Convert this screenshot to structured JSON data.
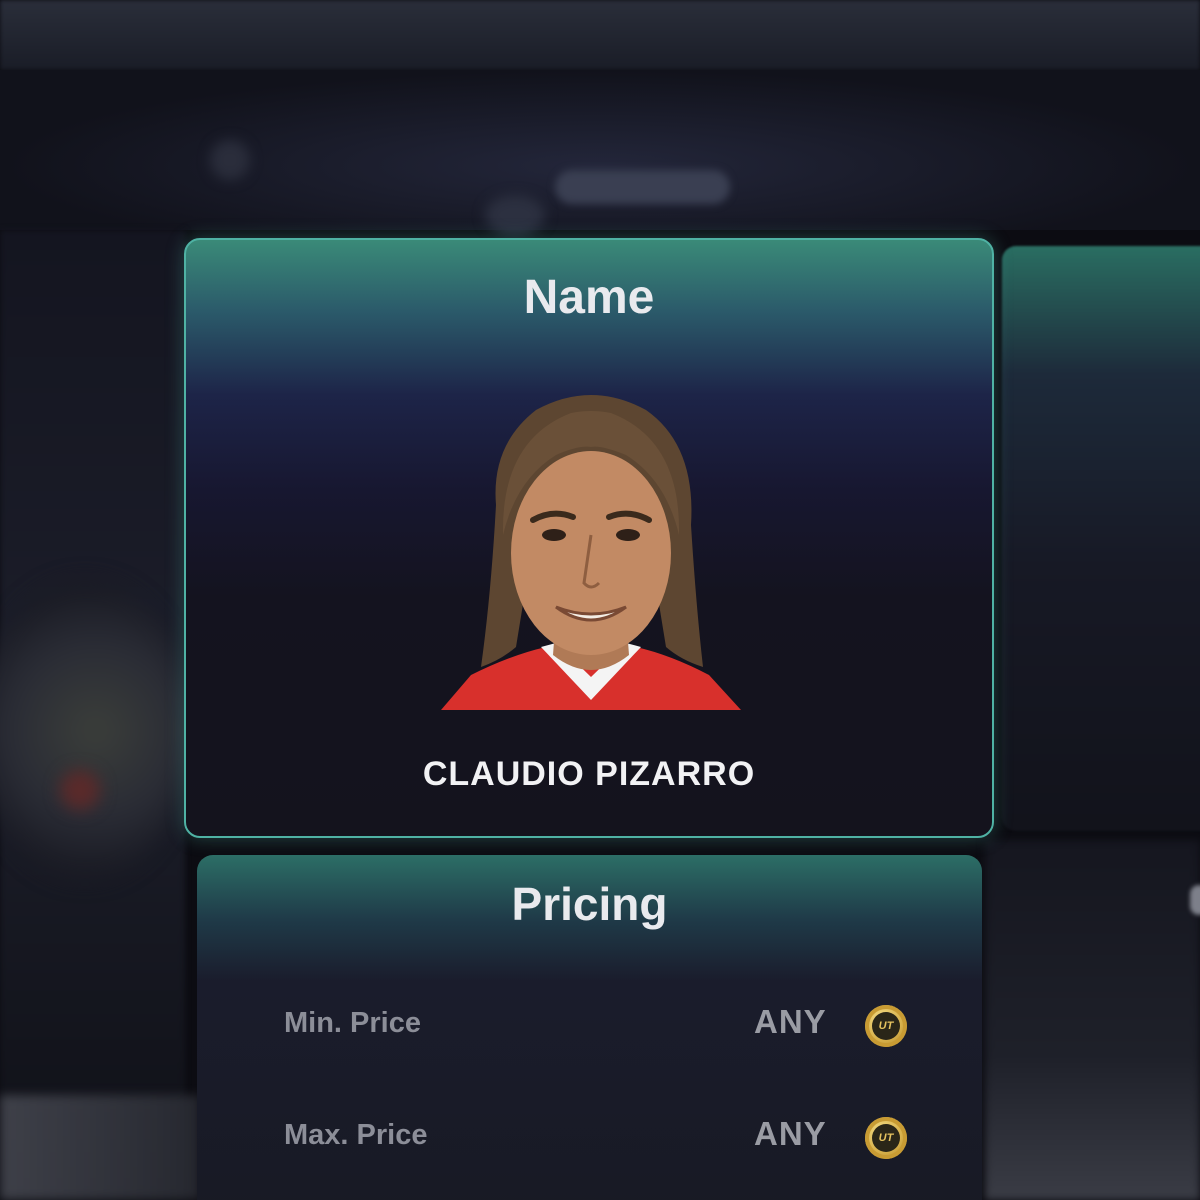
{
  "name_card": {
    "title": "Name",
    "player_name": "CLAUDIO PIZARRO",
    "portrait_icon": "player-portrait-icon"
  },
  "pricing_card": {
    "title": "Pricing",
    "rows": [
      {
        "label": "Min. Price",
        "value": "ANY",
        "icon": "coin-icon"
      },
      {
        "label": "Max. Price",
        "value": "ANY",
        "icon": "coin-icon"
      }
    ],
    "coin_text": "UT"
  },
  "colors": {
    "accent": "#4fb2a4",
    "coin": "#d7b04a",
    "background": "#0c0c12"
  }
}
